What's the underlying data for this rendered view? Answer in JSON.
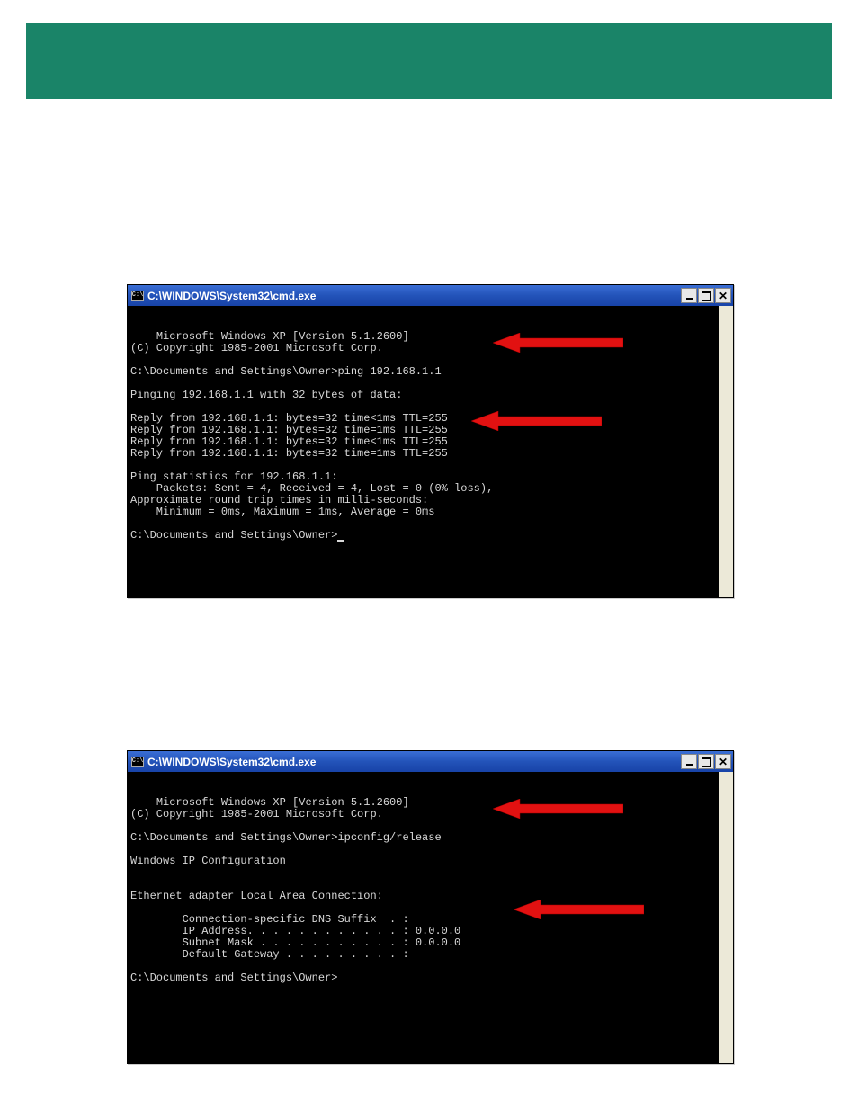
{
  "window1": {
    "title": "C:\\WINDOWS\\System32\\cmd.exe",
    "icon_glyph": "C:\\",
    "lines": [
      "Microsoft Windows XP [Version 5.1.2600]",
      "(C) Copyright 1985-2001 Microsoft Corp.",
      "",
      "C:\\Documents and Settings\\Owner>ping 192.168.1.1",
      "",
      "Pinging 192.168.1.1 with 32 bytes of data:",
      "",
      "Reply from 192.168.1.1: bytes=32 time<1ms TTL=255",
      "Reply from 192.168.1.1: bytes=32 time=1ms TTL=255",
      "Reply from 192.168.1.1: bytes=32 time<1ms TTL=255",
      "Reply from 192.168.1.1: bytes=32 time=1ms TTL=255",
      "",
      "Ping statistics for 192.168.1.1:",
      "    Packets: Sent = 4, Received = 4, Lost = 0 (0% loss),",
      "Approximate round trip times in milli-seconds:",
      "    Minimum = 0ms, Maximum = 1ms, Average = 0ms",
      "",
      "C:\\Documents and Settings\\Owner>"
    ]
  },
  "window2": {
    "title": "C:\\WINDOWS\\System32\\cmd.exe",
    "icon_glyph": "C:\\",
    "lines": [
      "Microsoft Windows XP [Version 5.1.2600]",
      "(C) Copyright 1985-2001 Microsoft Corp.",
      "",
      "C:\\Documents and Settings\\Owner>ipconfig/release",
      "",
      "Windows IP Configuration",
      "",
      "",
      "Ethernet adapter Local Area Connection:",
      "",
      "        Connection-specific DNS Suffix  . :",
      "        IP Address. . . . . . . . . . . . : 0.0.0.0",
      "        Subnet Mask . . . . . . . . . . . : 0.0.0.0",
      "        Default Gateway . . . . . . . . . :",
      "",
      "C:\\Documents and Settings\\Owner>"
    ]
  },
  "arrow_color": "#e21111"
}
